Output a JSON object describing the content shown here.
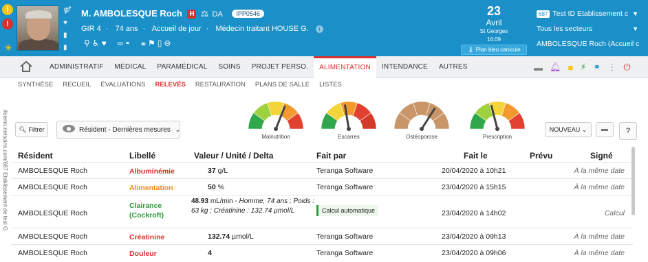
{
  "header": {
    "alerts": {
      "info": "i",
      "warn": "!"
    },
    "patient_name": "M. AMBOLESQUE Roch",
    "hospital_badge": "H",
    "da_label": "DA",
    "ipp": "IPP0546",
    "gir": "GIR 4",
    "age": "74 ans",
    "care_type": "Accueil de jour",
    "doctor": "Médecin traitant HOUSE G.",
    "bg_color": "#1a8fc8"
  },
  "date_box": {
    "day": "23",
    "month": "Avril",
    "saint": "St Georges",
    "time": "16:09",
    "plan_label": "Plan bleu canicule"
  },
  "selectors": {
    "establishment_number": "687",
    "establishment": "Test ID Etablissement c",
    "sector": "Tous les secteurs",
    "resident": "AMBOLESQUE Roch (Accueil c"
  },
  "main_tabs": [
    {
      "label": "Administratif",
      "name": "tab-administratif"
    },
    {
      "label": "Médical",
      "name": "tab-medical"
    },
    {
      "label": "Paramédical",
      "name": "tab-paramedical"
    },
    {
      "label": "Soins",
      "name": "tab-soins"
    },
    {
      "label": "Projet perso.",
      "name": "tab-projet-perso"
    },
    {
      "label": "Alimentation",
      "name": "tab-alimentation",
      "active": true
    },
    {
      "label": "Intendance",
      "name": "tab-intendance"
    },
    {
      "label": "Autres",
      "name": "tab-autres"
    }
  ],
  "sub_tabs": [
    {
      "label": "Synthèse"
    },
    {
      "label": "Recueil"
    },
    {
      "label": "Évaluations"
    },
    {
      "label": "Relevés",
      "active": true
    },
    {
      "label": "Restauration"
    },
    {
      "label": "Plans de salle"
    },
    {
      "label": "Listes"
    }
  ],
  "vertical_url": "ifoemo.netsoins.com/687 Etablissement de test G",
  "toolbar": {
    "filter_label": "Filtrer",
    "view_label": "Résident - Dernières mesures",
    "new_label": "NOUVEAU",
    "help_label": "?"
  },
  "gauges": [
    {
      "label": "Malnutrition",
      "level": 0.62
    },
    {
      "label": "Escarres",
      "level": 0.45
    },
    {
      "label": "Ostéoporose",
      "level": 0.68
    },
    {
      "label": "Prescription",
      "level": 0.42
    }
  ],
  "table": {
    "headers": {
      "resident": "Résident",
      "libelle": "Libellé",
      "valeur": "Valeur /  Unité /  Delta",
      "fait_par": "Fait par",
      "fait_le": "Fait le",
      "prevu": "Prévu",
      "signe": "Signé"
    },
    "rows": [
      {
        "resident": "AMBOLESQUE Roch",
        "libelle": "Albuminémie",
        "libelle_color": "red",
        "value": "37",
        "unit": "g/L",
        "fait_par": "Teranga Software",
        "fait_le": "20/04/2020 à 10h21",
        "signe": "À la même date"
      },
      {
        "resident": "AMBOLESQUE Roch",
        "libelle": "Alimentation",
        "libelle_color": "orange",
        "value": "50",
        "unit": "%",
        "fait_par": "Teranga Software",
        "fait_le": "23/04/2020 à 15h15",
        "signe": "À la même date"
      },
      {
        "resident": "AMBOLESQUE Roch",
        "libelle": "Clairance (Cockroft)",
        "libelle_color": "green",
        "value": "48.93",
        "unit": "mL/min",
        "details": "Homme, 74 ans ; Poids : 63 kg ; Créatinine : 132.74 µmol/L",
        "fait_par": "Calcul automatique",
        "fait_le": "23/04/2020 à 14h02",
        "signe": "Calcul"
      },
      {
        "resident": "AMBOLESQUE Roch",
        "libelle": "Créatinine",
        "libelle_color": "red",
        "value": "132.74",
        "unit": "µmol/L",
        "fait_par": "Teranga Software",
        "fait_le": "23/04/2020 à 09h13",
        "signe": "À la même date"
      },
      {
        "resident": "AMBOLESQUE Roch",
        "libelle": "Douleur",
        "libelle_color": "red",
        "value": "4",
        "unit": "",
        "fait_par": "Teranga Software",
        "fait_le": "23/04/2020 à 09h06",
        "signe": "À la même date"
      }
    ]
  }
}
